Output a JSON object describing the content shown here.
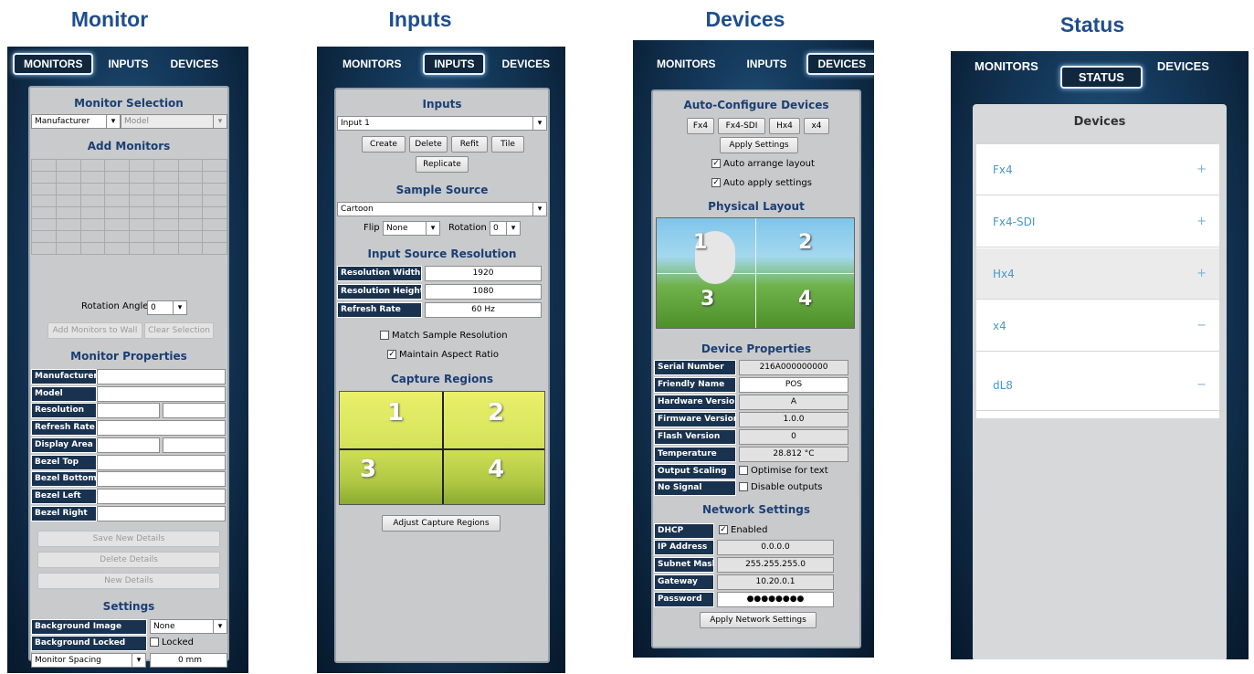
{
  "headers": {
    "monitor": "Monitor",
    "inputs": "Inputs",
    "devices": "Devices",
    "status": "Status"
  },
  "tabs": {
    "monitors": "MONITORS",
    "inputs": "INPUTS",
    "devices": "DEVICES",
    "status": "STATUS"
  },
  "monitor": {
    "selection_title": "Monitor Selection",
    "manufacturer": "Manufacturer",
    "model": "Model",
    "add_title": "Add Monitors",
    "rotation_label": "Rotation Angle",
    "rotation_value": "0",
    "add_button": "Add Monitors to Wall",
    "clear_button": "Clear Selection",
    "props_title": "Monitor Properties",
    "props": [
      "Manufacturer",
      "Model",
      "Resolution",
      "Refresh Rate",
      "Display Area",
      "Bezel Top",
      "Bezel Bottom",
      "Bezel Left",
      "Bezel Right"
    ],
    "save_button": "Save New Details",
    "delete_button": "Delete Details",
    "new_button": "New Details",
    "settings_title": "Settings",
    "bg_image_label": "Background Image",
    "bg_image_value": "None",
    "bg_locked_label": "Background Locked",
    "locked": "Locked",
    "spacing_label": "Monitor Spacing",
    "spacing_value": "0 mm"
  },
  "inputs": {
    "title": "Inputs",
    "input_value": "Input 1",
    "buttons": {
      "create": "Create",
      "delete": "Delete",
      "refit": "Refit",
      "tile": "Tile",
      "replicate": "Replicate"
    },
    "sample_title": "Sample Source",
    "sample_value": "Cartoon",
    "flip_label": "Flip",
    "flip_value": "None",
    "rotation_label": "Rotation",
    "rotation_value": "0",
    "res_title": "Input Source Resolution",
    "res_rows": [
      {
        "label": "Resolution Width",
        "value": "1920"
      },
      {
        "label": "Resolution Height",
        "value": "1080"
      },
      {
        "label": "Refresh Rate",
        "value": "60 Hz"
      }
    ],
    "match": "Match Sample Resolution",
    "aspect": "Maintain Aspect Ratio",
    "capture_title": "Capture Regions",
    "regions": [
      "1",
      "2",
      "3",
      "4"
    ],
    "adjust_button": "Adjust Capture Regions"
  },
  "devices": {
    "auto_title": "Auto-Configure Devices",
    "device_buttons": [
      "Fx4",
      "Fx4-SDI",
      "Hx4",
      "x4"
    ],
    "apply_button": "Apply Settings",
    "auto_arrange": "Auto arrange layout",
    "auto_apply": "Auto apply settings",
    "layout_title": "Physical Layout",
    "regions": [
      "1",
      "2",
      "3",
      "4"
    ],
    "props_title": "Device Properties",
    "props": [
      {
        "label": "Serial Number",
        "value": "216A000000000"
      },
      {
        "label": "Friendly Name",
        "value": "POS"
      },
      {
        "label": "Hardware Version",
        "value": "A"
      },
      {
        "label": "Firmware Version",
        "value": "1.0.0"
      },
      {
        "label": "Flash Version",
        "value": "0"
      },
      {
        "label": "Temperature",
        "value": "28.812 °C"
      }
    ],
    "output_scaling_label": "Output Scaling",
    "output_scaling_value": "Optimise for text",
    "no_signal_label": "No Signal",
    "no_signal_value": "Disable outputs",
    "net_title": "Network Settings",
    "dhcp_label": "DHCP",
    "dhcp_value": "Enabled",
    "net": [
      {
        "label": "IP Address",
        "value": "0.0.0.0"
      },
      {
        "label": "Subnet Mask",
        "value": "255.255.255.0"
      },
      {
        "label": "Gateway",
        "value": "10.20.0.1"
      },
      {
        "label": "Password",
        "value": "●●●●●●●●"
      }
    ],
    "apply_net_button": "Apply Network Settings"
  },
  "status": {
    "title": "Devices",
    "items": [
      {
        "name": "Fx4",
        "sign": "+"
      },
      {
        "name": "Fx4-SDI",
        "sign": "+"
      },
      {
        "name": "Hx4",
        "sign": "+"
      },
      {
        "name": "x4",
        "sign": "−"
      },
      {
        "name": "dL8",
        "sign": "−"
      }
    ]
  }
}
